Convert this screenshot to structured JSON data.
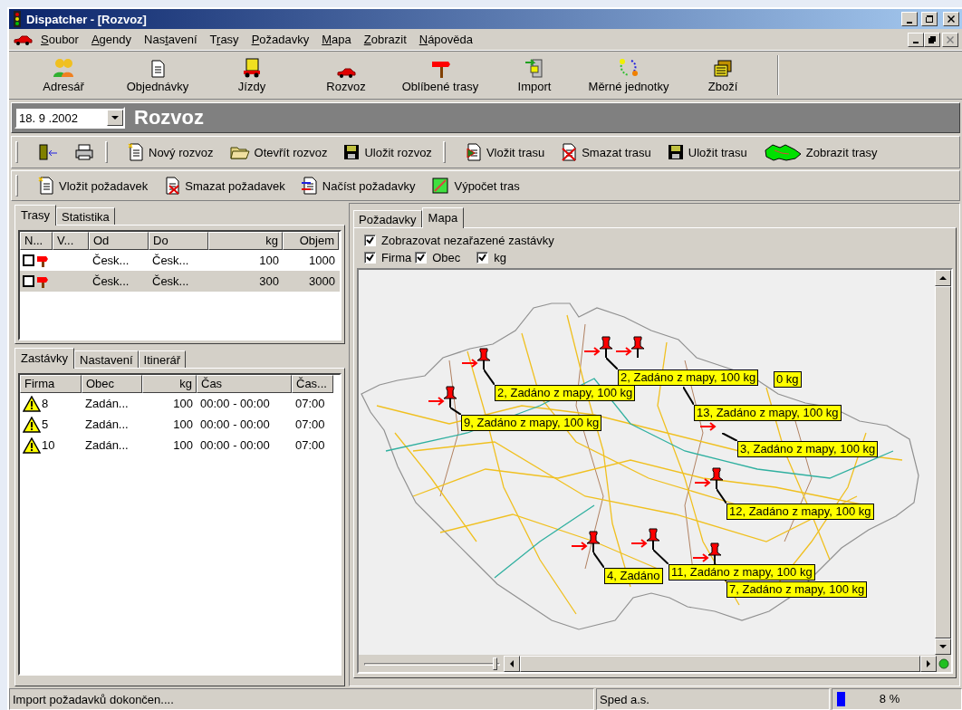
{
  "window": {
    "title": "Dispatcher - [Rozvoz]"
  },
  "menu": [
    {
      "key": "S",
      "post": "oubor"
    },
    {
      "key": "A",
      "post": "gendy"
    },
    {
      "pre": "Nas",
      "key": "t",
      "post": "avení"
    },
    {
      "pre": "T",
      "key": "r",
      "post": "asy"
    },
    {
      "key": "P",
      "post": "ožadavky"
    },
    {
      "key": "M",
      "post": "apa"
    },
    {
      "key": "Z",
      "post": "obrazit"
    },
    {
      "key": "N",
      "post": "ápověda"
    }
  ],
  "main_toolbar": [
    {
      "label": "Adresář"
    },
    {
      "label": "Objednávky"
    },
    {
      "label": "Jízdy"
    },
    {
      "label": "Rozvoz"
    },
    {
      "label": "Oblíbené trasy"
    },
    {
      "label": "Import"
    },
    {
      "label": "Měrné jednotky"
    },
    {
      "label": "Zboží"
    }
  ],
  "header": {
    "date": "18. 9 .2002",
    "title": "Rozvoz"
  },
  "toolbar_rozvoz": [
    "Nový rozvoz",
    "Otevřít rozvoz",
    "Uložit rozvoz"
  ],
  "toolbar_trasa": [
    "Vložit trasu",
    "Smazat trasu",
    "Uložit trasu",
    "Zobrazit trasy"
  ],
  "toolbar_pozadavky": [
    "Vložit požadavek",
    "Smazat požadavek",
    "Načíst požadavky",
    "Výpočet tras"
  ],
  "left_tabs": [
    {
      "label": "Trasy",
      "selected": true
    },
    {
      "label": "Statistika",
      "selected": false
    }
  ],
  "routes": {
    "columns": [
      "N...",
      "V...",
      "Od",
      "Do",
      "kg",
      "Objem"
    ],
    "rows": [
      {
        "checked": false,
        "selected": false,
        "cells": [
          "",
          "",
          "Česk...",
          "Česk...",
          "100",
          "1000"
        ]
      },
      {
        "checked": false,
        "selected": true,
        "cells": [
          "",
          "",
          "Česk...",
          "Česk...",
          "300",
          "3000"
        ]
      }
    ]
  },
  "detail_tabs": [
    {
      "label": "Zastávky",
      "selected": true
    },
    {
      "label": "Nastavení",
      "selected": false
    },
    {
      "label": "Itinerář",
      "selected": false
    }
  ],
  "stops": {
    "columns": [
      "Firma",
      "Obec",
      "kg",
      "Čas",
      "Čas..."
    ],
    "rows": [
      {
        "cells": [
          "8",
          "Zadán...",
          "100",
          "00:00 - 00:00",
          "07:00"
        ]
      },
      {
        "cells": [
          "5",
          "Zadán...",
          "100",
          "00:00 - 00:00",
          "07:00"
        ]
      },
      {
        "cells": [
          "10",
          "Zadán...",
          "100",
          "00:00 - 00:00",
          "07:00"
        ]
      }
    ]
  },
  "right_tabs": [
    {
      "label": "Požadavky",
      "selected": false
    },
    {
      "label": "Mapa",
      "selected": true
    }
  ],
  "map_options": [
    {
      "label": "Zobrazovat nezařazené zastávky",
      "checked": true
    },
    {
      "label": "Firma",
      "checked": true
    },
    {
      "label": "Obec",
      "checked": true
    },
    {
      "label": "kg",
      "checked": true
    }
  ],
  "map": {
    "zoom": {
      "level": 0.98
    },
    "stops": [
      {
        "label": "2, Zadáno z mapy, 100 kg"
      },
      {
        "label": "0 kg"
      },
      {
        "label": "2, Zadáno z mapy, 100 kg"
      },
      {
        "label": "13, Zadáno z mapy, 100 kg"
      },
      {
        "label": "9, Zadáno z mapy, 100 kg"
      },
      {
        "label": "3, Zadáno z mapy, 100 kg"
      },
      {
        "label": "12, Zadáno z mapy, 100 kg"
      },
      {
        "label": "4, Zadáno"
      },
      {
        "label": "11, Zadáno z mapy, 100 kg"
      },
      {
        "label": "7, Zadáno z mapy, 100 kg"
      }
    ]
  },
  "status_bar": {
    "message": "Import požadavků dokončen....",
    "company": "Sped a.s.",
    "progress": {
      "level": 0.08,
      "reading": "8 %"
    }
  }
}
